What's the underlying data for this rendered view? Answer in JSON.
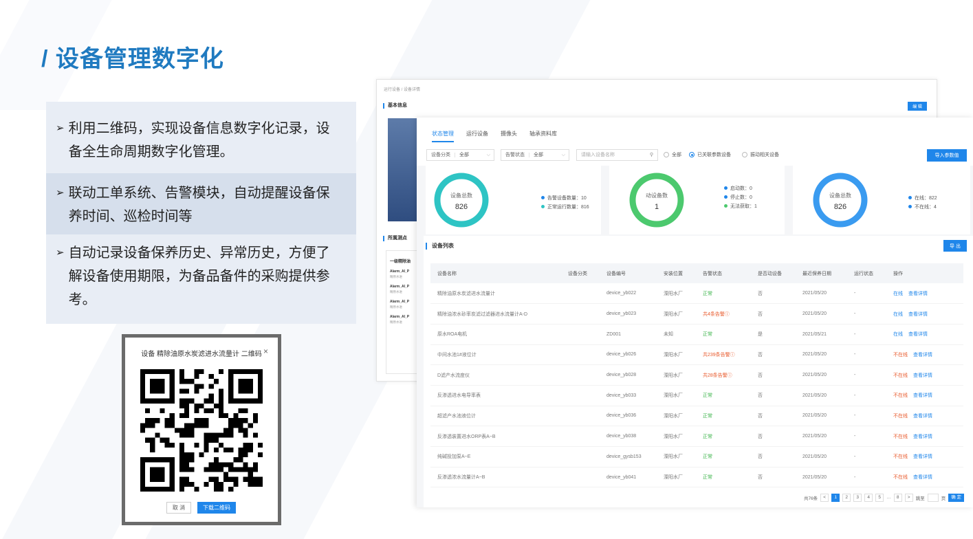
{
  "slide": {
    "title": "/ 设备管理数字化",
    "bullets": [
      "利用二维码，实现设备信息数字化记录，设备全生命周期数字化管理。",
      "联动工单系统、告警模块，自动提醒设备保养时间、巡检时间等",
      "自动记录设备保养历史、异常历史，方便了解设备使用期限，为备品备件的采购提供参考。"
    ],
    "bullet_marker": "➢"
  },
  "qr_dialog": {
    "title": "设备 精除油原水炭滤进水流量计 二维码",
    "close": "×",
    "cancel": "取 消",
    "download": "下载二维码"
  },
  "detail_panel": {
    "breadcrumb": "运行设备 / 设备详情",
    "basic_info": "基本信息",
    "edit": "编 辑",
    "points_title": "所属测点",
    "points_head": "一级精除油",
    "points": [
      {
        "name": "Alarm_AI_P",
        "sub": "精原水进"
      },
      {
        "name": "Alarm_AI_P",
        "sub": "精原水进"
      },
      {
        "name": "Alarm_AI_P",
        "sub": "精原水进"
      },
      {
        "name": "Alarm_AI_P",
        "sub": "精原水进"
      }
    ]
  },
  "tabs": [
    "状态管理",
    "运行设备",
    "摄像头",
    "轴承资料库"
  ],
  "filters": {
    "category_label": "设备分类",
    "category_value": "全部",
    "alarm_label": "告警状态",
    "alarm_value": "全部",
    "search_placeholder": "请输入设备名称",
    "radios": [
      "全部",
      "已关联参数设备",
      "振动相关设备"
    ],
    "import": "导入参数值"
  },
  "summary_cards": [
    {
      "label": "设备总数",
      "value": "826",
      "ring_color": "#2ec4c4",
      "legend": [
        {
          "text": "告警设备数量：10",
          "color": "#1f86ea"
        },
        {
          "text": "正常运行数量：816",
          "color": "#2ec4c4"
        }
      ]
    },
    {
      "label": "动设备数",
      "value": "1",
      "ring_color": "#4cc96e",
      "legend": [
        {
          "text": "启动数：0",
          "color": "#1f86ea"
        },
        {
          "text": "停止数：0",
          "color": "#1f86ea"
        },
        {
          "text": "无法获取：1",
          "color": "#4cc96e"
        }
      ]
    },
    {
      "label": "设备总数",
      "value": "826",
      "ring_color": "#3a9bf0",
      "legend": [
        {
          "text": "在线：822",
          "color": "#1f86ea"
        },
        {
          "text": "不在线：4",
          "color": "#1f86ea"
        }
      ]
    }
  ],
  "list": {
    "title": "设备列表",
    "export": "导 出",
    "columns": [
      "设备名称",
      "设备分类",
      "设备编号",
      "安装位置",
      "告警状态",
      "是否动设备",
      "最近保养日期",
      "运行状态",
      "操作"
    ],
    "rows": [
      {
        "name": "精除油原水炭滤进水流量计",
        "cat": "",
        "code": "device_yb022",
        "loc": "溧阳水厂",
        "alarm": "正常",
        "alarm_type": "ok",
        "moving": "否",
        "date": "2021/05/20",
        "run": "-",
        "status": "在线",
        "status_type": "on",
        "detail": "查看详情"
      },
      {
        "name": "精除油浓水砂率炭滤过滤器进水流量计A-D",
        "cat": "",
        "code": "device_yb023",
        "loc": "溧阳水厂",
        "alarm": "共4条告警ⓘ",
        "alarm_type": "alarm",
        "moving": "否",
        "date": "2021/05/20",
        "run": "-",
        "status": "在线",
        "status_type": "on",
        "detail": "查看详情"
      },
      {
        "name": "原水ROA电机",
        "cat": "",
        "code": "ZD001",
        "loc": "未知",
        "alarm": "正常",
        "alarm_type": "ok",
        "moving": "是",
        "date": "2021/05/21",
        "run": "-",
        "status": "在线",
        "status_type": "on",
        "detail": "查看详情"
      },
      {
        "name": "中间水池1#液位计",
        "cat": "",
        "code": "device_yb026",
        "loc": "溧阳水厂",
        "alarm": "共239条告警ⓘ",
        "alarm_type": "alarm",
        "moving": "否",
        "date": "2021/05/20",
        "run": "-",
        "status": "不在线",
        "status_type": "off",
        "detail": "查看详情"
      },
      {
        "name": "D滤产水流度仪",
        "cat": "",
        "code": "device_yb028",
        "loc": "溧阳水厂",
        "alarm": "共28条告警ⓘ",
        "alarm_type": "alarm",
        "moving": "否",
        "date": "2021/05/20",
        "run": "-",
        "status": "不在线",
        "status_type": "off",
        "detail": "查看详情"
      },
      {
        "name": "反渗透进水电导率表",
        "cat": "",
        "code": "device_yb033",
        "loc": "溧阳水厂",
        "alarm": "正常",
        "alarm_type": "ok",
        "moving": "否",
        "date": "2021/05/20",
        "run": "-",
        "status": "不在线",
        "status_type": "off",
        "detail": "查看详情"
      },
      {
        "name": "超滤产水池液位计",
        "cat": "",
        "code": "device_yb036",
        "loc": "溧阳水厂",
        "alarm": "正常",
        "alarm_type": "ok",
        "moving": "否",
        "date": "2021/05/20",
        "run": "-",
        "status": "不在线",
        "status_type": "off",
        "detail": "查看详情"
      },
      {
        "name": "反渗透装置进水ORP表A~B",
        "cat": "",
        "code": "device_yb038",
        "loc": "溧阳水厂",
        "alarm": "正常",
        "alarm_type": "ok",
        "moving": "否",
        "date": "2021/05/20",
        "run": "-",
        "status": "不在线",
        "status_type": "off",
        "detail": "查看详情"
      },
      {
        "name": "纯碱投加泵A~E",
        "cat": "",
        "code": "device_gysb153",
        "loc": "溧阳水厂",
        "alarm": "正常",
        "alarm_type": "ok",
        "moving": "否",
        "date": "2021/05/20",
        "run": "-",
        "status": "不在线",
        "status_type": "off",
        "detail": "查看详情"
      },
      {
        "name": "反渗透浓水流量计A~B",
        "cat": "",
        "code": "device_yb041",
        "loc": "溧阳水厂",
        "alarm": "正常",
        "alarm_type": "ok",
        "moving": "否",
        "date": "2021/05/20",
        "run": "-",
        "status": "不在线",
        "status_type": "off",
        "detail": "查看详情"
      }
    ]
  },
  "pagination": {
    "total": "共76条",
    "prev": "<",
    "pages": [
      "1",
      "2",
      "3",
      "4",
      "5"
    ],
    "ellipsis": "···",
    "last": "8",
    "next": ">",
    "jump": "跳至",
    "page_unit": "页",
    "confirm": "确 定",
    "current": "1"
  }
}
